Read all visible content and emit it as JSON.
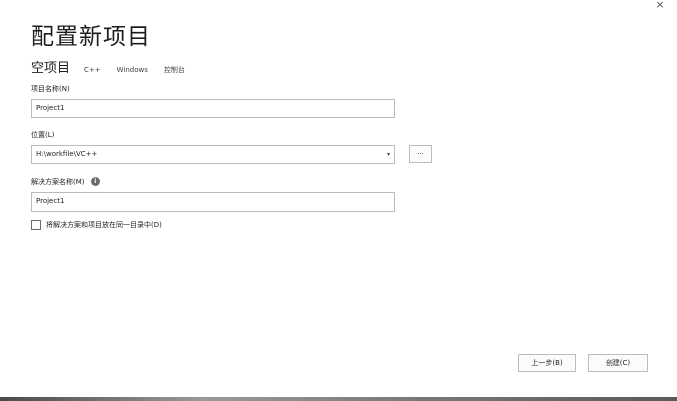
{
  "window": {
    "close_glyph": "×",
    "title": "配置新项目"
  },
  "template": {
    "name": "空项目",
    "tags": [
      "C++",
      "Windows",
      "控制台"
    ]
  },
  "project_name": {
    "label": "项目名称(N)",
    "value": "Project1"
  },
  "location": {
    "label": "位置(L)",
    "value": "H:\\workfile\\VC++",
    "browse_label": "..."
  },
  "solution_name": {
    "label": "解决方案名称(M)",
    "info_icon": "info-icon",
    "value": "Project1"
  },
  "same_directory": {
    "label": "将解决方案和项目放在同一目录中(D)",
    "checked": false
  },
  "buttons": {
    "back": "上一步(B)",
    "create": "创建(C)"
  }
}
